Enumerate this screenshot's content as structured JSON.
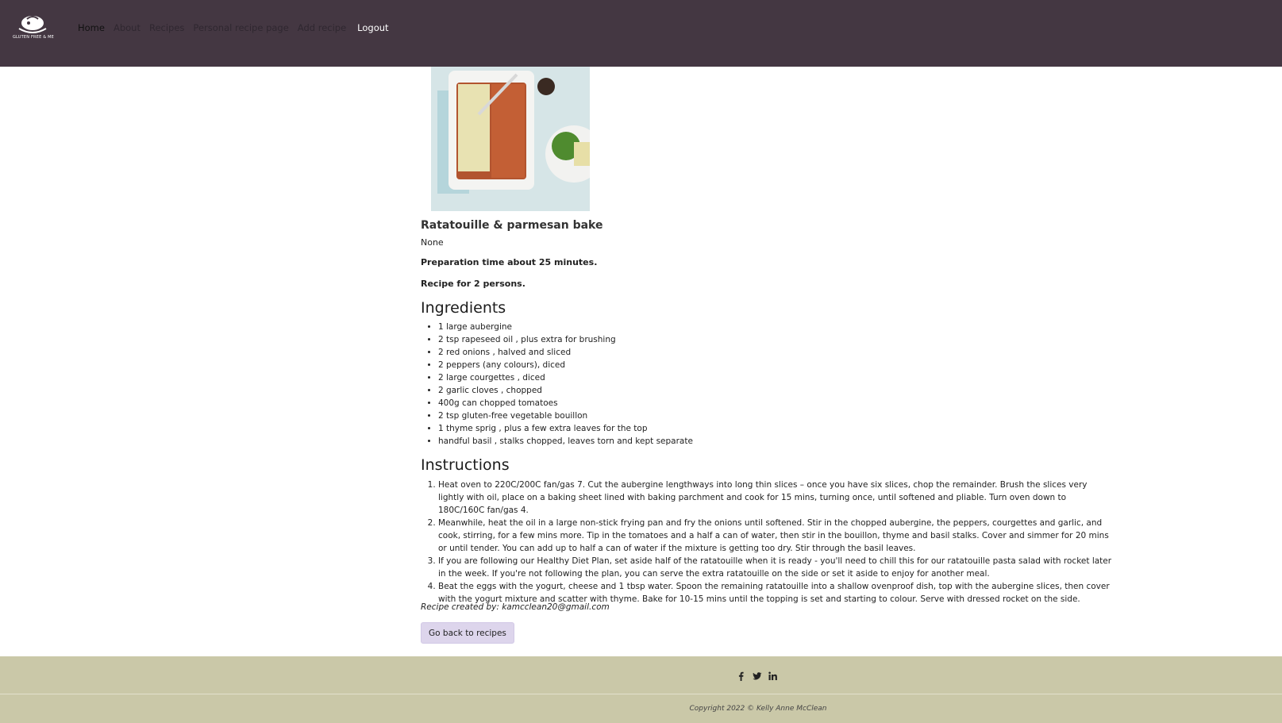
{
  "nav": {
    "logo_text": "GLUTEN FREE & ME",
    "links": [
      "Home",
      "About",
      "Recipes",
      "Personal recipe page",
      "Add recipe",
      "Logout"
    ]
  },
  "recipe": {
    "title": "Ratatouille & parmesan bake",
    "description": "None",
    "prep_time": "Preparation time about 25 minutes.",
    "servings": "Recipe for 2 persons.",
    "ingredients_heading": "Ingredients",
    "ingredients": [
      "1 large aubergine",
      "2 tsp rapeseed oil , plus extra for brushing",
      "2 red onions , halved and sliced",
      "2 peppers (any colours), diced",
      "2 large courgettes , diced",
      "2 garlic cloves , chopped",
      "400g can chopped tomatoes",
      "2 tsp gluten-free vegetable bouillon",
      "1 thyme sprig , plus a few extra leaves for the top",
      "handful basil , stalks chopped, leaves torn and kept separate"
    ],
    "instructions_heading": "Instructions",
    "instructions": [
      "Heat oven to 220C/200C fan/gas 7. Cut the aubergine lengthways into long thin slices – once you have six slices, chop the remainder. Brush the slices very lightly with oil, place on a baking sheet lined with baking parchment and cook for 15 mins, turning once, until softened and pliable. Turn oven down to 180C/160C fan/gas 4.",
      "Meanwhile, heat the oil in a large non-stick frying pan and fry the onions until softened. Stir in the chopped aubergine, the peppers, courgettes and garlic, and cook, stirring, for a few mins more. Tip in the tomatoes and a half a can of water, then stir in the bouillon, thyme and basil stalks. Cover and simmer for 20 mins or until tender. You can add up to half a can of water if the mixture is getting too dry. Stir through the basil leaves.",
      "If you are following our Healthy Diet Plan, set aside half of the ratatouille when it is ready - you'll need to chill this for our ratatouille pasta salad with rocket later in the week. If you're not following the plan, you can serve the extra ratatouille on the side or set it aside to enjoy for another meal.",
      "Beat the eggs with the yogurt, cheese and 1 tbsp water. Spoon the remaining ratatouille into a shallow ovenproof dish, top with the aubergine slices, then cover with the yogurt mixture and scatter with thyme. Bake for 10-15 mins until the topping is set and starting to colour. Serve with dressed rocket on the side."
    ],
    "created_by": "Recipe created by: kamcclean20@gmail.com",
    "back_button": "Go back to recipes"
  },
  "footer": {
    "social_icons": [
      "facebook-icon",
      "twitter-icon",
      "linkedin-icon"
    ],
    "copyright": "Copyright 2022 © Kelly Anne McClean"
  },
  "colors": {
    "navbar": "#443742",
    "footer": "#cac8a8",
    "button": "#ddd5ec"
  }
}
